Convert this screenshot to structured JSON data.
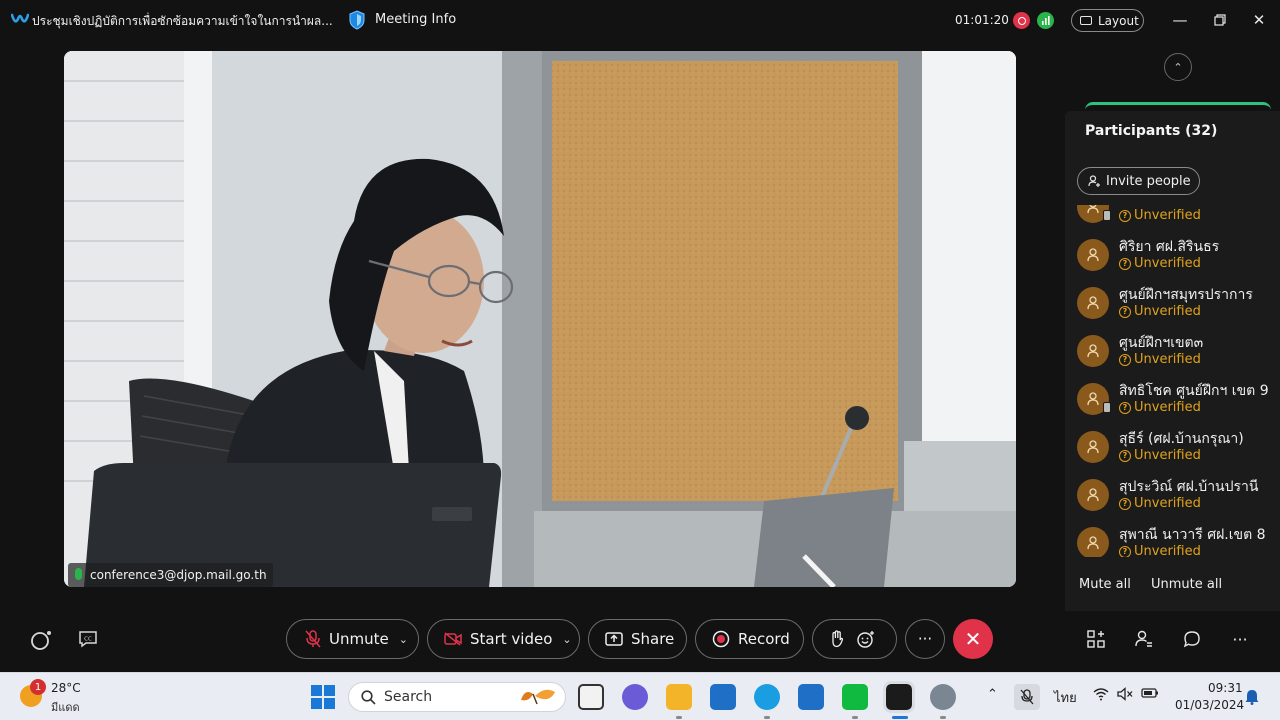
{
  "titlebar": {
    "meeting_title": "ประชุมเชิงปฏิบัติการเพื่อซักซ้อมความเข้าใจในการนำผล...",
    "meeting_info": "Meeting Info",
    "timer": "01:01:20",
    "layout_label": "Layout"
  },
  "video": {
    "participant_email": "conference3@djop.mail.go.th"
  },
  "participants": {
    "title": "Participants (32)",
    "invite_label": "Invite people",
    "items": [
      {
        "name": "",
        "status": "Unverified"
      },
      {
        "name": "ศิริยา ศฝ.สิรินธร",
        "status": "Unverified"
      },
      {
        "name": "ศูนย์ฝึกฯสมุทรปราการ",
        "status": "Unverified"
      },
      {
        "name": "ศูนย์ฝึกฯเขต๓",
        "status": "Unverified"
      },
      {
        "name": "สิทธิโชค ศูนย์ฝึกฯ เขต 9",
        "status": "Unverified"
      },
      {
        "name": "สุธีร์ (ศฝ.บ้านกรุณา)",
        "status": "Unverified"
      },
      {
        "name": "สุประวิณ์ ศฝ.บ้านปรานี",
        "status": "Unverified"
      },
      {
        "name": "สุพาณี นาวารี ศฝ.เขต 8",
        "status": "Unverified"
      }
    ],
    "mute_all": "Mute all",
    "unmute_all": "Unmute all"
  },
  "controls": {
    "unmute": "Unmute",
    "start_video": "Start video",
    "share": "Share",
    "record": "Record",
    "more": "···"
  },
  "taskbar": {
    "temperature": "28°C",
    "condition": "มีแดด",
    "weather_badge": "1",
    "search_placeholder": "Search",
    "language": "ไทย",
    "time": "09:31",
    "date": "01/03/2024"
  },
  "colors": {
    "accent_red": "#e0334a",
    "accent_green": "#2bb44a",
    "unverified": "#e0a21b",
    "avatar": "#8a5a1c"
  }
}
